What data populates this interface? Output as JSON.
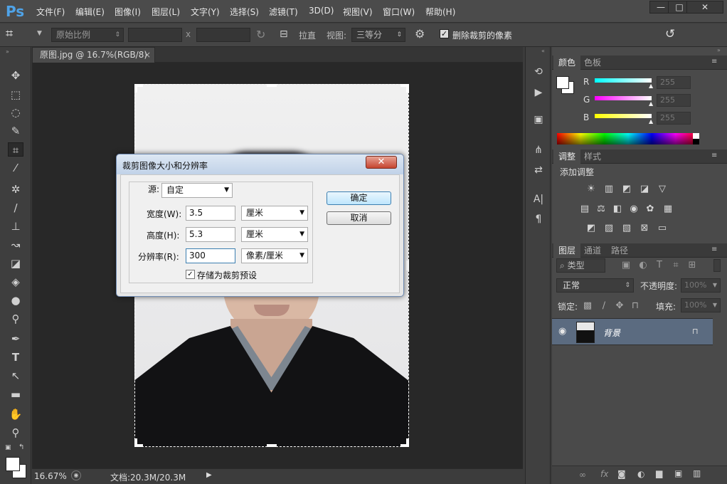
{
  "app": {
    "logo": "Ps"
  },
  "menu": [
    "文件(F)",
    "编辑(E)",
    "图像(I)",
    "图层(L)",
    "文字(Y)",
    "选择(S)",
    "滤镜(T)",
    "3D(D)",
    "视图(V)",
    "窗口(W)",
    "帮助(H)"
  ],
  "window_buttons": {
    "minimize": "—",
    "maximize": "□",
    "close": "✕"
  },
  "options": {
    "ratio_preset": "原始比例",
    "width_value": "",
    "height_value": "",
    "separator_x": "x",
    "straighten_label": "拉直",
    "view_label": "视图:",
    "view_value": "三等分",
    "delete_cropped_label": "删除裁剪的像素",
    "delete_cropped_checked": true
  },
  "document": {
    "tab_title": "原图.jpg @ 16.7%(RGB/8)",
    "tab_close": "×"
  },
  "status": {
    "zoom": "16.67%",
    "doc_info": "文档:20.3M/20.3M"
  },
  "color_panel": {
    "tabs": [
      "颜色",
      "色板"
    ],
    "channels": [
      {
        "label": "R",
        "value": "255",
        "gradient_to": "#00ffff"
      },
      {
        "label": "G",
        "value": "255",
        "gradient_to": "#ff00ff"
      },
      {
        "label": "B",
        "value": "255",
        "gradient_to": "#ffff00"
      }
    ]
  },
  "adjust_panel": {
    "tabs": [
      "调整",
      "样式"
    ],
    "title": "添加调整"
  },
  "layers_panel": {
    "tabs": [
      "图层",
      "通道",
      "路径"
    ],
    "filter_kind": "类型",
    "blend_mode": "正常",
    "opacity_label": "不透明度:",
    "opacity_value": "100%",
    "lock_label": "锁定:",
    "fill_label": "填充:",
    "fill_value": "100%",
    "layers": [
      {
        "name": "背景",
        "visible": true,
        "locked": true
      }
    ]
  },
  "dialog": {
    "title": "裁剪图像大小和分辨率",
    "close": "✕",
    "source_label": "源:",
    "source_value": "自定",
    "width_label": "宽度(W):",
    "width_value": "3.5",
    "width_unit": "厘米",
    "height_label": "高度(H):",
    "height_value": "5.3",
    "height_unit": "厘米",
    "resolution_label": "分辨率(R):",
    "resolution_value": "300",
    "resolution_unit": "像素/厘米",
    "save_preset_label": "存储为裁剪预设",
    "save_preset_checked": true,
    "ok": "确定",
    "cancel": "取消"
  },
  "colors": {
    "accent": "#4fa3e8",
    "layer_selected": "#5b6b80"
  }
}
